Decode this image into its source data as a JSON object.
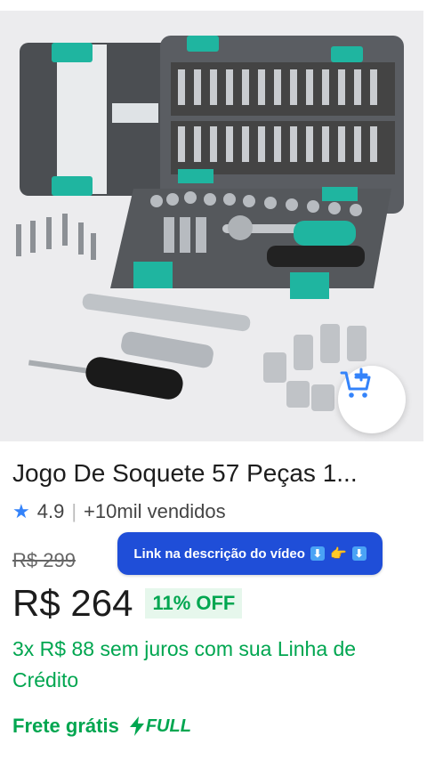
{
  "product": {
    "title": "Jogo De Soquete 57 Peças 1...",
    "rating": "4.9",
    "sold": "+10mil vendidos",
    "old_price": "R$ 299",
    "price": "R$ 264",
    "discount": "11% OFF",
    "installments": "3x R$ 88 sem juros com sua Linha de Crédito",
    "shipping": "Frete grátis",
    "full_label": "FULL"
  },
  "overlay": {
    "promo_text": "Link na descrição do vídeo"
  },
  "icons": {
    "rating": "star-icon",
    "cart": "add-to-cart-icon",
    "full": "lightning-icon"
  },
  "colors": {
    "accent_blue": "#3483fa",
    "green": "#00a650",
    "promo_blue": "#1f4ed8",
    "case_teal": "#1fb5a0"
  }
}
